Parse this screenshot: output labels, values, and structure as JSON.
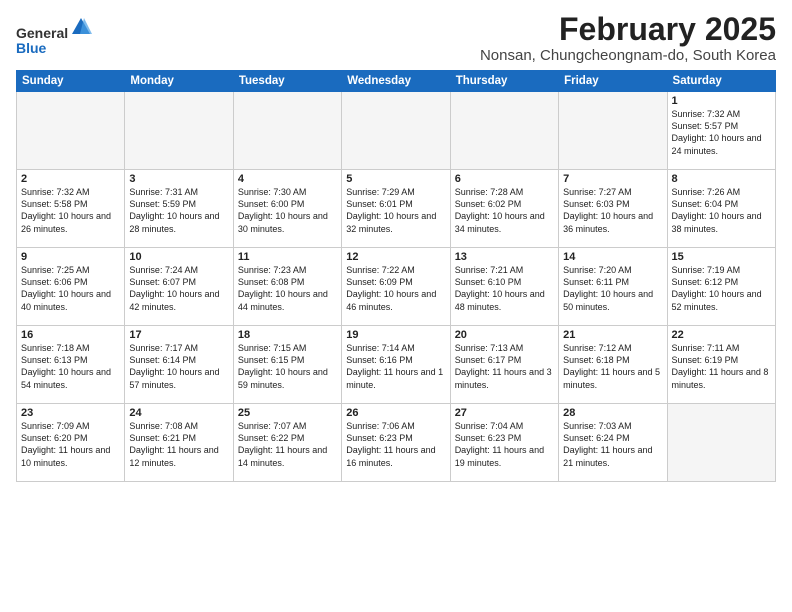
{
  "header": {
    "logo_general": "General",
    "logo_blue": "Blue",
    "month_title": "February 2025",
    "location": "Nonsan, Chungcheongnam-do, South Korea"
  },
  "weekdays": [
    "Sunday",
    "Monday",
    "Tuesday",
    "Wednesday",
    "Thursday",
    "Friday",
    "Saturday"
  ],
  "weeks": [
    [
      {
        "day": "",
        "info": ""
      },
      {
        "day": "",
        "info": ""
      },
      {
        "day": "",
        "info": ""
      },
      {
        "day": "",
        "info": ""
      },
      {
        "day": "",
        "info": ""
      },
      {
        "day": "",
        "info": ""
      },
      {
        "day": "1",
        "info": "Sunrise: 7:32 AM\nSunset: 5:57 PM\nDaylight: 10 hours and 24 minutes."
      }
    ],
    [
      {
        "day": "2",
        "info": "Sunrise: 7:32 AM\nSunset: 5:58 PM\nDaylight: 10 hours and 26 minutes."
      },
      {
        "day": "3",
        "info": "Sunrise: 7:31 AM\nSunset: 5:59 PM\nDaylight: 10 hours and 28 minutes."
      },
      {
        "day": "4",
        "info": "Sunrise: 7:30 AM\nSunset: 6:00 PM\nDaylight: 10 hours and 30 minutes."
      },
      {
        "day": "5",
        "info": "Sunrise: 7:29 AM\nSunset: 6:01 PM\nDaylight: 10 hours and 32 minutes."
      },
      {
        "day": "6",
        "info": "Sunrise: 7:28 AM\nSunset: 6:02 PM\nDaylight: 10 hours and 34 minutes."
      },
      {
        "day": "7",
        "info": "Sunrise: 7:27 AM\nSunset: 6:03 PM\nDaylight: 10 hours and 36 minutes."
      },
      {
        "day": "8",
        "info": "Sunrise: 7:26 AM\nSunset: 6:04 PM\nDaylight: 10 hours and 38 minutes."
      }
    ],
    [
      {
        "day": "9",
        "info": "Sunrise: 7:25 AM\nSunset: 6:06 PM\nDaylight: 10 hours and 40 minutes."
      },
      {
        "day": "10",
        "info": "Sunrise: 7:24 AM\nSunset: 6:07 PM\nDaylight: 10 hours and 42 minutes."
      },
      {
        "day": "11",
        "info": "Sunrise: 7:23 AM\nSunset: 6:08 PM\nDaylight: 10 hours and 44 minutes."
      },
      {
        "day": "12",
        "info": "Sunrise: 7:22 AM\nSunset: 6:09 PM\nDaylight: 10 hours and 46 minutes."
      },
      {
        "day": "13",
        "info": "Sunrise: 7:21 AM\nSunset: 6:10 PM\nDaylight: 10 hours and 48 minutes."
      },
      {
        "day": "14",
        "info": "Sunrise: 7:20 AM\nSunset: 6:11 PM\nDaylight: 10 hours and 50 minutes."
      },
      {
        "day": "15",
        "info": "Sunrise: 7:19 AM\nSunset: 6:12 PM\nDaylight: 10 hours and 52 minutes."
      }
    ],
    [
      {
        "day": "16",
        "info": "Sunrise: 7:18 AM\nSunset: 6:13 PM\nDaylight: 10 hours and 54 minutes."
      },
      {
        "day": "17",
        "info": "Sunrise: 7:17 AM\nSunset: 6:14 PM\nDaylight: 10 hours and 57 minutes."
      },
      {
        "day": "18",
        "info": "Sunrise: 7:15 AM\nSunset: 6:15 PM\nDaylight: 10 hours and 59 minutes."
      },
      {
        "day": "19",
        "info": "Sunrise: 7:14 AM\nSunset: 6:16 PM\nDaylight: 11 hours and 1 minute."
      },
      {
        "day": "20",
        "info": "Sunrise: 7:13 AM\nSunset: 6:17 PM\nDaylight: 11 hours and 3 minutes."
      },
      {
        "day": "21",
        "info": "Sunrise: 7:12 AM\nSunset: 6:18 PM\nDaylight: 11 hours and 5 minutes."
      },
      {
        "day": "22",
        "info": "Sunrise: 7:11 AM\nSunset: 6:19 PM\nDaylight: 11 hours and 8 minutes."
      }
    ],
    [
      {
        "day": "23",
        "info": "Sunrise: 7:09 AM\nSunset: 6:20 PM\nDaylight: 11 hours and 10 minutes."
      },
      {
        "day": "24",
        "info": "Sunrise: 7:08 AM\nSunset: 6:21 PM\nDaylight: 11 hours and 12 minutes."
      },
      {
        "day": "25",
        "info": "Sunrise: 7:07 AM\nSunset: 6:22 PM\nDaylight: 11 hours and 14 minutes."
      },
      {
        "day": "26",
        "info": "Sunrise: 7:06 AM\nSunset: 6:23 PM\nDaylight: 11 hours and 16 minutes."
      },
      {
        "day": "27",
        "info": "Sunrise: 7:04 AM\nSunset: 6:23 PM\nDaylight: 11 hours and 19 minutes."
      },
      {
        "day": "28",
        "info": "Sunrise: 7:03 AM\nSunset: 6:24 PM\nDaylight: 11 hours and 21 minutes."
      },
      {
        "day": "",
        "info": ""
      }
    ]
  ]
}
